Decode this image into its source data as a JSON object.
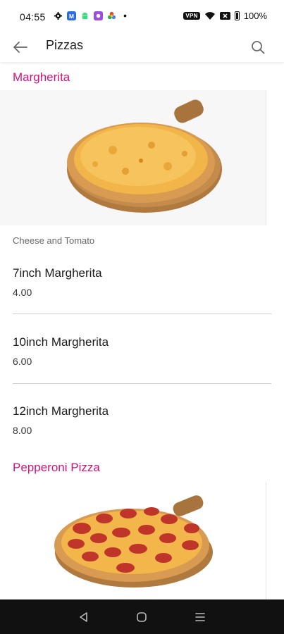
{
  "status_bar": {
    "time": "04:55",
    "vpn": "VPN",
    "battery": "100%"
  },
  "app_bar": {
    "title": "Pizzas",
    "back_icon": "arrow-left-icon",
    "search_icon": "search-icon"
  },
  "sections": [
    {
      "title": "Margherita",
      "description": "Cheese and Tomato",
      "items": [
        {
          "name": "7inch Margherita",
          "price": "4.00"
        },
        {
          "name": "10inch Margherita",
          "price": "6.00"
        },
        {
          "name": "12inch Margherita",
          "price": "8.00"
        }
      ]
    },
    {
      "title": "Pepperoni Pizza"
    }
  ],
  "colors": {
    "accent": "#d6127a",
    "nav_bar": "#111111"
  }
}
